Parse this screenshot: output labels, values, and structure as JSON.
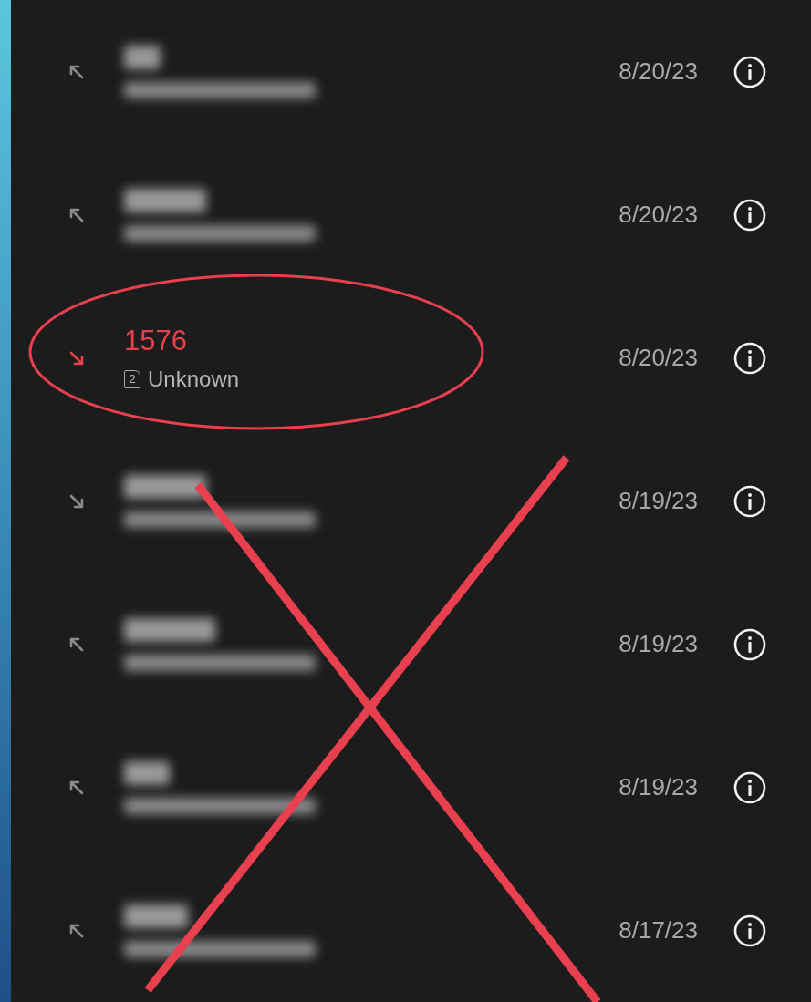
{
  "calls": [
    {
      "kind": "outgoing",
      "blurred": true,
      "date": "8/20/23"
    },
    {
      "kind": "outgoing",
      "blurred": true,
      "date": "8/20/23"
    },
    {
      "kind": "missed",
      "blurred": false,
      "number": "1576",
      "sim": "2",
      "label": "Unknown",
      "date": "8/20/23"
    },
    {
      "kind": "incoming",
      "blurred": true,
      "date": "8/19/23"
    },
    {
      "kind": "outgoing",
      "blurred": true,
      "date": "8/19/23"
    },
    {
      "kind": "outgoing",
      "blurred": true,
      "date": "8/19/23"
    },
    {
      "kind": "outgoing",
      "blurred": true,
      "date": "8/17/23"
    }
  ],
  "circled": true,
  "crossed_out": true
}
